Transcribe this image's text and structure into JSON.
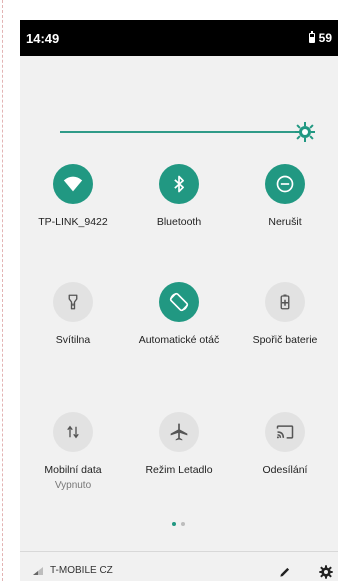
{
  "status_bar": {
    "time": "14:49",
    "battery_percent": "59"
  },
  "brightness": {
    "level": 1.0
  },
  "tiles": [
    {
      "label": "TP-LINK_9422",
      "sub": "",
      "state": "on",
      "icon": "wifi-icon"
    },
    {
      "label": "Bluetooth",
      "sub": "",
      "state": "on",
      "icon": "bluetooth-icon"
    },
    {
      "label": "Nerušit",
      "sub": "",
      "state": "on",
      "icon": "do-not-disturb-icon"
    },
    {
      "label": "Svítilna",
      "sub": "",
      "state": "off",
      "icon": "flashlight-icon"
    },
    {
      "label": "Automatické otáč",
      "sub": "",
      "state": "on",
      "icon": "auto-rotate-icon"
    },
    {
      "label": "Spořič baterie",
      "sub": "",
      "state": "off",
      "icon": "battery-saver-icon"
    },
    {
      "label": "Mobilní data",
      "sub": "Vypnuto",
      "state": "off",
      "icon": "mobile-data-icon"
    },
    {
      "label": "Režim Letadlo",
      "sub": "",
      "state": "off",
      "icon": "airplane-icon"
    },
    {
      "label": "Odesílání",
      "sub": "",
      "state": "off",
      "icon": "cast-icon"
    }
  ],
  "pager": {
    "pages": 2,
    "active": 1
  },
  "bottom": {
    "carrier": "T-MOBILE CZ"
  },
  "colors": {
    "accent": "#219882",
    "tile_off": "#e2e2e2",
    "panel_bg": "#f1f1f1"
  }
}
